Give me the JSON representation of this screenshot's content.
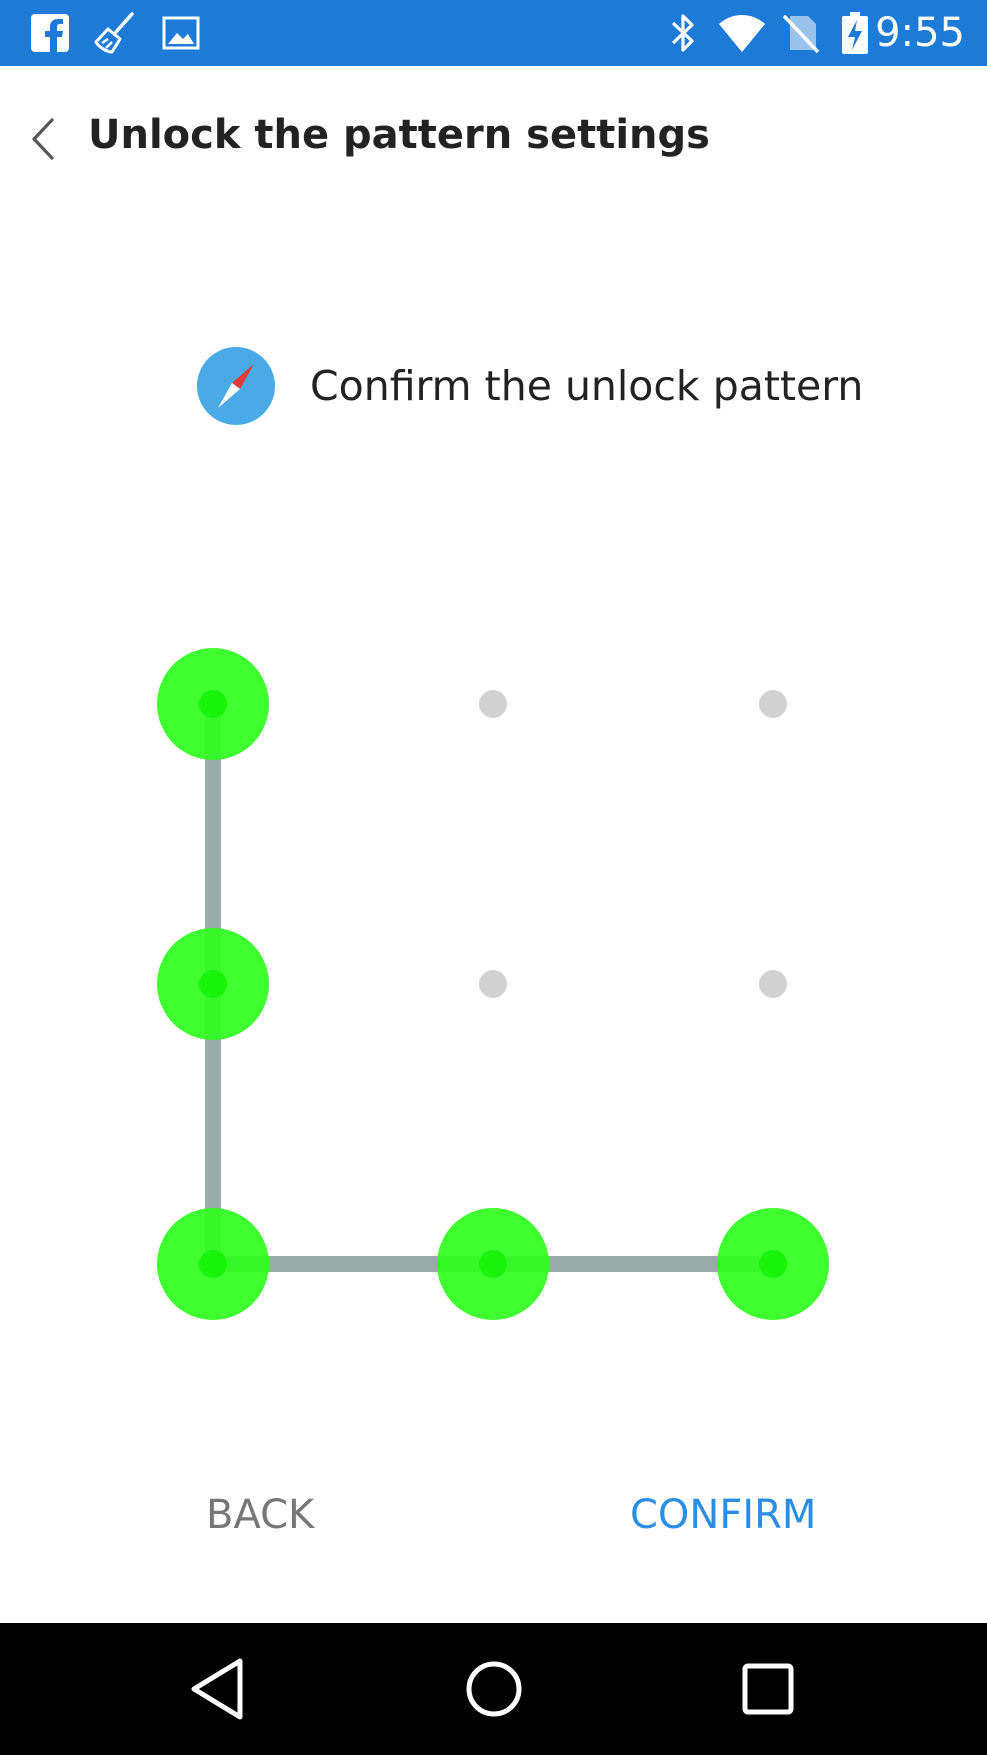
{
  "status_bar": {
    "time": "9:55",
    "left_icons": [
      "facebook-icon",
      "cleaner-broom-icon",
      "gallery-image-icon"
    ],
    "right_icons": [
      "bluetooth-icon",
      "wifi-icon",
      "no-sim-icon",
      "battery-charging-icon"
    ],
    "background_color": "#1d7ad6"
  },
  "header": {
    "title": "Unlock the pattern settings"
  },
  "prompt": {
    "text": "Confirm the unlock pattern",
    "icon": "compass-icon"
  },
  "pattern": {
    "grid_size": 3,
    "selected_sequence": [
      0,
      3,
      6,
      7,
      8
    ],
    "selected_color": "#2bff1a",
    "line_color": "#9aaba8",
    "dot_color": "#d2d2d2"
  },
  "buttons": {
    "back_label": "BACK",
    "confirm_label": "CONFIRM",
    "accent_color": "#2b8ee5"
  },
  "nav_bar": {
    "icons": [
      "nav-back-icon",
      "nav-home-icon",
      "nav-recents-icon"
    ]
  }
}
